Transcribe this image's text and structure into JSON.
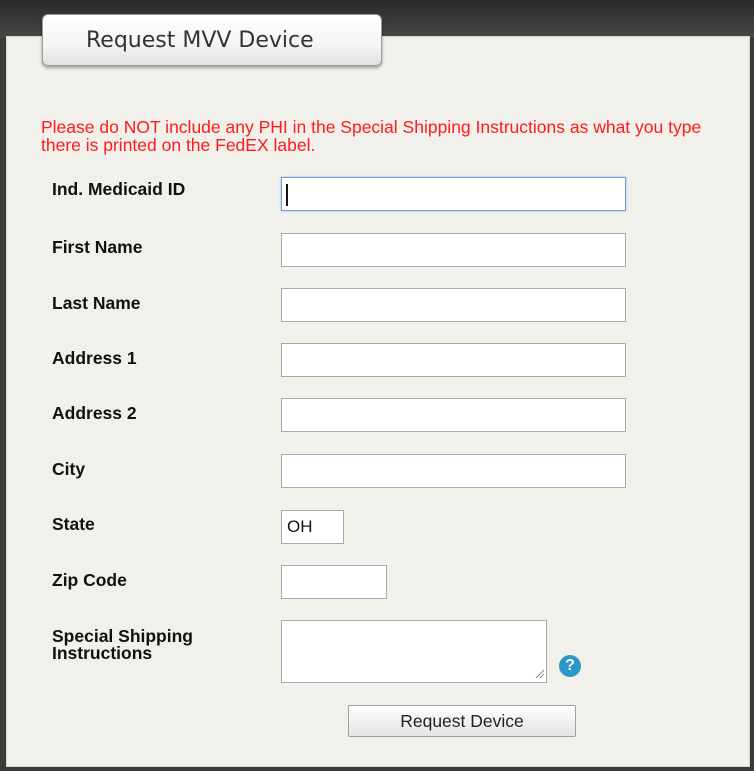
{
  "tab": {
    "title": "Request MVV Device"
  },
  "notice": "Please do NOT include any PHI in the Special Shipping Instructions as what you type there is printed on the FedEX label.",
  "form": {
    "fields": [
      {
        "label": "Ind. Medicaid ID",
        "value": ""
      },
      {
        "label": "First Name",
        "value": ""
      },
      {
        "label": "Last Name",
        "value": ""
      },
      {
        "label": "Address 1",
        "value": ""
      },
      {
        "label": "Address 2",
        "value": ""
      },
      {
        "label": "City",
        "value": ""
      },
      {
        "label": "State",
        "value": "OH"
      },
      {
        "label": "Zip Code",
        "value": ""
      },
      {
        "label": "Special Shipping Instructions",
        "value": ""
      }
    ]
  },
  "help_icon": {
    "glyph": "?",
    "color": "#2a97c8"
  },
  "submit": {
    "label": "Request Device"
  },
  "colors": {
    "notice": "#ff1b1b",
    "panel": "#f2f0ea"
  }
}
